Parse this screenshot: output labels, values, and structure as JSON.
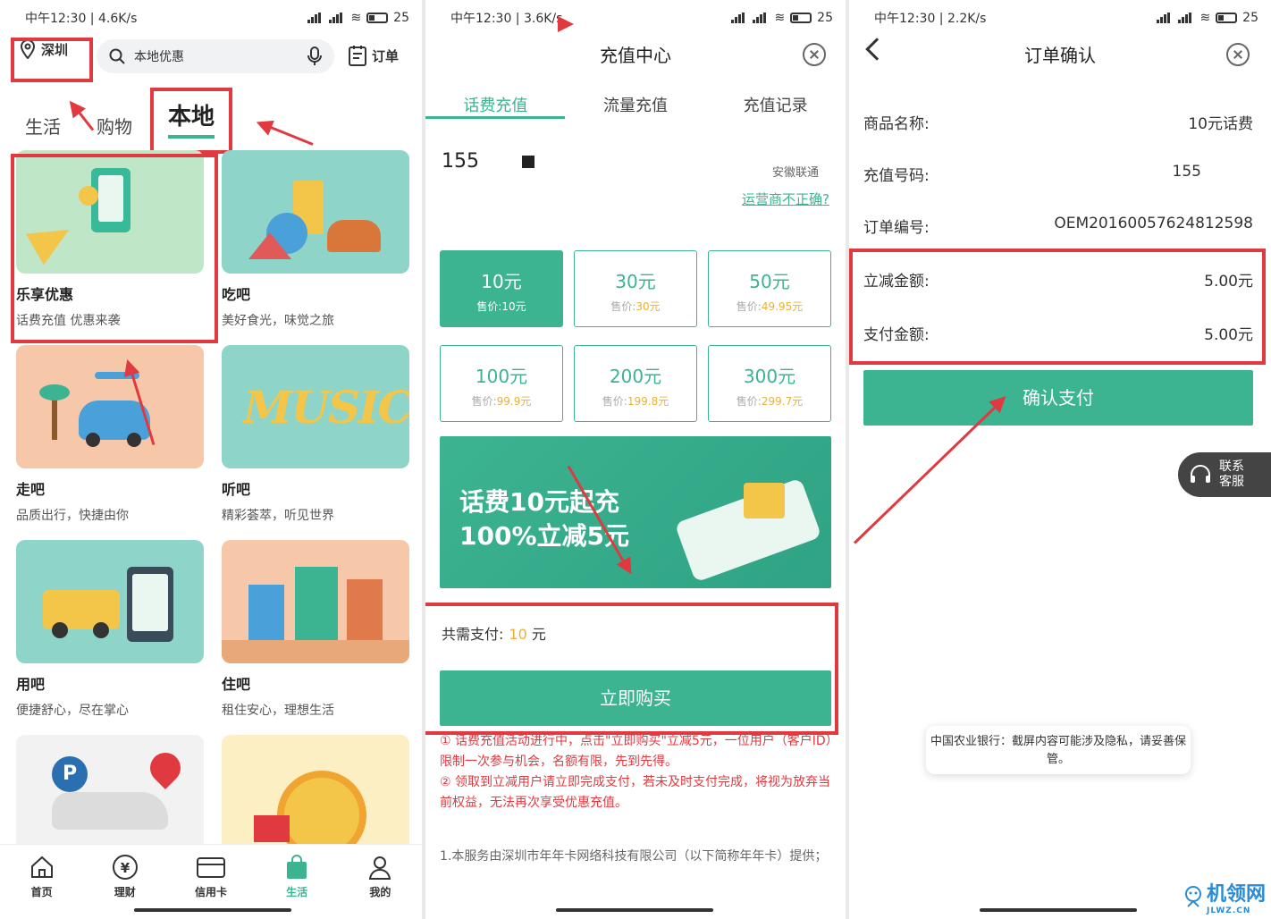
{
  "colors": {
    "accent": "#3cb391",
    "annotation": "#e0393f",
    "price": "#e9b233"
  },
  "panels": [
    {
      "status": {
        "time": "中午12:30 | 4.6K/s",
        "battery": "25"
      }
    },
    {
      "status": {
        "time": "中午12:30 | 3.6K/s",
        "battery": "25"
      }
    },
    {
      "status": {
        "time": "中午12:30 | 2.2K/s",
        "battery": "25"
      }
    }
  ],
  "p1": {
    "location": "深圳",
    "search_placeholder": "本地优惠",
    "orders": "订单",
    "categories": {
      "life": "生活",
      "shop": "购物",
      "local": "本地"
    },
    "cards": [
      {
        "title": "乐享优惠",
        "sub": "话费充值  优惠来袭"
      },
      {
        "title": "吃吧",
        "sub": "美好食光，味觉之旅"
      },
      {
        "title": "走吧",
        "sub": "品质出行，快捷由你"
      },
      {
        "title": "听吧",
        "sub": "精彩荟萃，听见世界",
        "art": "MUSIC"
      },
      {
        "title": "用吧",
        "sub": "便捷舒心，尽在掌心"
      },
      {
        "title": "住吧",
        "sub": "租住安心，理想生活"
      }
    ],
    "tabbar": [
      {
        "label": "首页",
        "icon": "home-icon"
      },
      {
        "label": "理财",
        "icon": "yen-icon"
      },
      {
        "label": "信用卡",
        "icon": "card-icon"
      },
      {
        "label": "生活",
        "icon": "bag-icon"
      },
      {
        "label": "我的",
        "icon": "user-icon"
      }
    ]
  },
  "p2": {
    "title": "充值中心",
    "tabs": [
      "话费充值",
      "流量充值",
      "充值记录"
    ],
    "phone": "155",
    "carrier": "安徽联通",
    "carrier_link": "运营商不正确?",
    "packages": [
      {
        "amount": "10元",
        "price_label": "售价:",
        "price": "10元",
        "selected": true
      },
      {
        "amount": "30元",
        "price_label": "售价:",
        "price": "30元"
      },
      {
        "amount": "50元",
        "price_label": "售价:",
        "price": "49.95元"
      },
      {
        "amount": "100元",
        "price_label": "售价:",
        "price": "99.9元"
      },
      {
        "amount": "200元",
        "price_label": "售价:",
        "price": "199.8元"
      },
      {
        "amount": "300元",
        "price_label": "售价:",
        "price": "299.7元"
      }
    ],
    "banner": {
      "line1": "话费10元起充",
      "line2": "100%立减5元"
    },
    "total_label": "共需支付:",
    "total_value": "10",
    "total_unit": "元",
    "buy_button": "立即购买",
    "notes": [
      "① 话费充值活动进行中，点击\"立即购买\"立减5元，一位用户（客户ID）限制一次参与机会，名额有限，先到先得。",
      "② 领取到立减用户请立即完成支付，若未及时支付完成，将视为放弃当前权益，无法再次享受优惠充值。"
    ],
    "terms": "1.本服务由深圳市年年卡网络科技有限公司（以下简称年年卡）提供；"
  },
  "p3": {
    "title": "订单确认",
    "rows": [
      {
        "label": "商品名称:",
        "value": "10元话费"
      },
      {
        "label": "充值号码:",
        "value": "155"
      },
      {
        "label": "订单编号:",
        "value": "OEM20160057624812598"
      },
      {
        "label": "立减金额:",
        "value": "5.00元"
      },
      {
        "label": "支付金额:",
        "value": "5.00元"
      }
    ],
    "pay_button": "确认支付",
    "customer_service": "联系客服",
    "toast": "中国农业银行：截屏内容可能涉及隐私，请妥善保管。",
    "watermark": "机领网",
    "watermark_sub": "JLWZ.CN"
  }
}
